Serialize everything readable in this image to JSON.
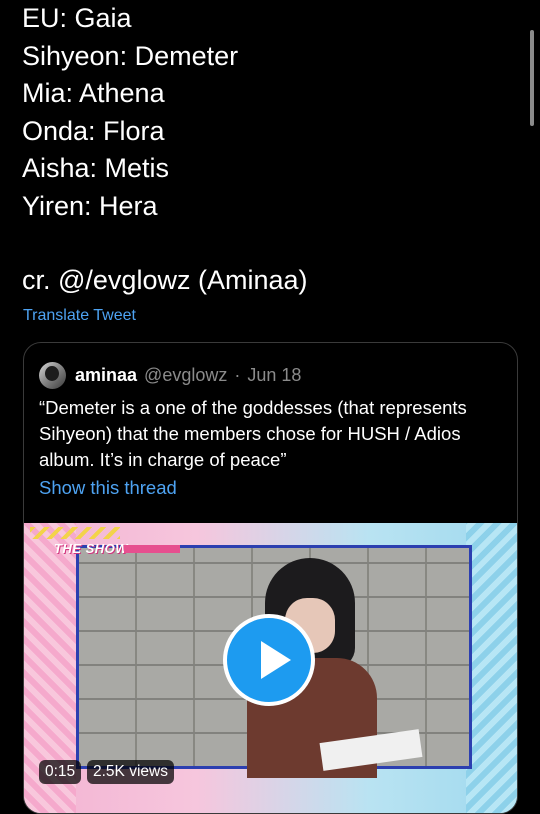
{
  "tweet": {
    "lines": [
      "EU: Gaia",
      "Sihyeon: Demeter",
      "Mia: Athena",
      "Onda: Flora",
      "Aisha: Metis",
      "Yiren: Hera"
    ],
    "credit": "cr. @/evglowz (Aminaa)",
    "translate_label": "Translate Tweet"
  },
  "quoted_tweet": {
    "name": "aminaa",
    "handle": "@evglowz",
    "separator": "·",
    "date": "Jun 18",
    "text": "“Demeter is a one of the goddesses (that represents Sihyeon) that the members chose for HUSH / Adios album. It’s in charge of peace”",
    "show_thread": "Show this thread",
    "media": {
      "show_logo": "THE SHOW",
      "duration": "0:15",
      "views": "2.5K views",
      "play_icon": "play-icon",
      "accent": "#1d9bf0"
    }
  },
  "colors": {
    "background": "#000000",
    "link": "#4ea3f2",
    "muted": "#8b8b8b"
  }
}
